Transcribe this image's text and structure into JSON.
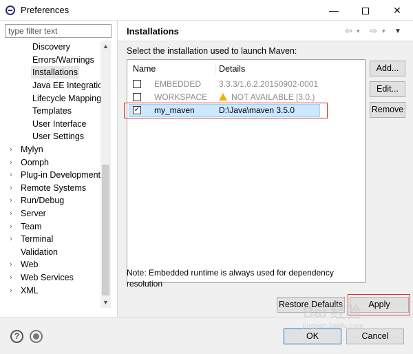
{
  "window": {
    "title": "Preferences",
    "min_glyph": "—",
    "close_glyph": "✕"
  },
  "filter": {
    "placeholder": "type filter text"
  },
  "tree": {
    "items": [
      {
        "label": "Discovery",
        "level": "child",
        "expandable": false,
        "selected": false
      },
      {
        "label": "Errors/Warnings",
        "level": "child",
        "expandable": false,
        "selected": false
      },
      {
        "label": "Installations",
        "level": "child",
        "expandable": false,
        "selected": true
      },
      {
        "label": "Java EE Integratio",
        "level": "child",
        "expandable": false,
        "selected": false
      },
      {
        "label": "Lifecycle Mapping",
        "level": "child",
        "expandable": false,
        "selected": false
      },
      {
        "label": "Templates",
        "level": "child",
        "expandable": false,
        "selected": false
      },
      {
        "label": "User Interface",
        "level": "child",
        "expandable": false,
        "selected": false
      },
      {
        "label": "User Settings",
        "level": "child",
        "expandable": false,
        "selected": false
      },
      {
        "label": "Mylyn",
        "level": "top",
        "expandable": true,
        "selected": false
      },
      {
        "label": "Oomph",
        "level": "top",
        "expandable": true,
        "selected": false
      },
      {
        "label": "Plug-in Development",
        "level": "top",
        "expandable": true,
        "selected": false
      },
      {
        "label": "Remote Systems",
        "level": "top",
        "expandable": true,
        "selected": false
      },
      {
        "label": "Run/Debug",
        "level": "top",
        "expandable": true,
        "selected": false
      },
      {
        "label": "Server",
        "level": "top",
        "expandable": true,
        "selected": false
      },
      {
        "label": "Team",
        "level": "top",
        "expandable": true,
        "selected": false
      },
      {
        "label": "Terminal",
        "level": "top",
        "expandable": true,
        "selected": false
      },
      {
        "label": "Validation",
        "level": "top",
        "expandable": false,
        "selected": false
      },
      {
        "label": "Web",
        "level": "top",
        "expandable": true,
        "selected": false
      },
      {
        "label": "Web Services",
        "level": "top",
        "expandable": true,
        "selected": false
      },
      {
        "label": "XML",
        "level": "top",
        "expandable": true,
        "selected": false
      }
    ]
  },
  "page": {
    "title": "Installations",
    "prompt": "Select the installation used to launch Maven:",
    "columns": {
      "name": "Name",
      "details": "Details"
    },
    "rows": [
      {
        "name": "EMBEDDED",
        "details": "3.3.3/1.6.2.20150902-0001",
        "checked": false,
        "enabled": false,
        "warning": false
      },
      {
        "name": "WORKSPACE",
        "details": "NOT AVAILABLE [3.0,)",
        "checked": false,
        "enabled": false,
        "warning": true
      },
      {
        "name": "my_maven",
        "details": "D:\\Java\\maven 3.5.0",
        "checked": true,
        "enabled": true,
        "warning": false
      }
    ],
    "side_buttons": {
      "add": "Add...",
      "edit": "Edit...",
      "remove": "Remove"
    },
    "note": "Note: Embedded runtime is always used for dependency resolution",
    "restore_defaults": "Restore Defaults",
    "apply": "Apply"
  },
  "footer": {
    "ok": "OK",
    "cancel": "Cancel"
  },
  "watermark": {
    "text": "Bai 经验",
    "sub": "jingyan.baidu.com"
  },
  "colors": {
    "selection": "#cce8ff",
    "highlight_box": "#d82c2c",
    "warning": "#f0b400",
    "dialog_bg": "#f0f0f0"
  }
}
